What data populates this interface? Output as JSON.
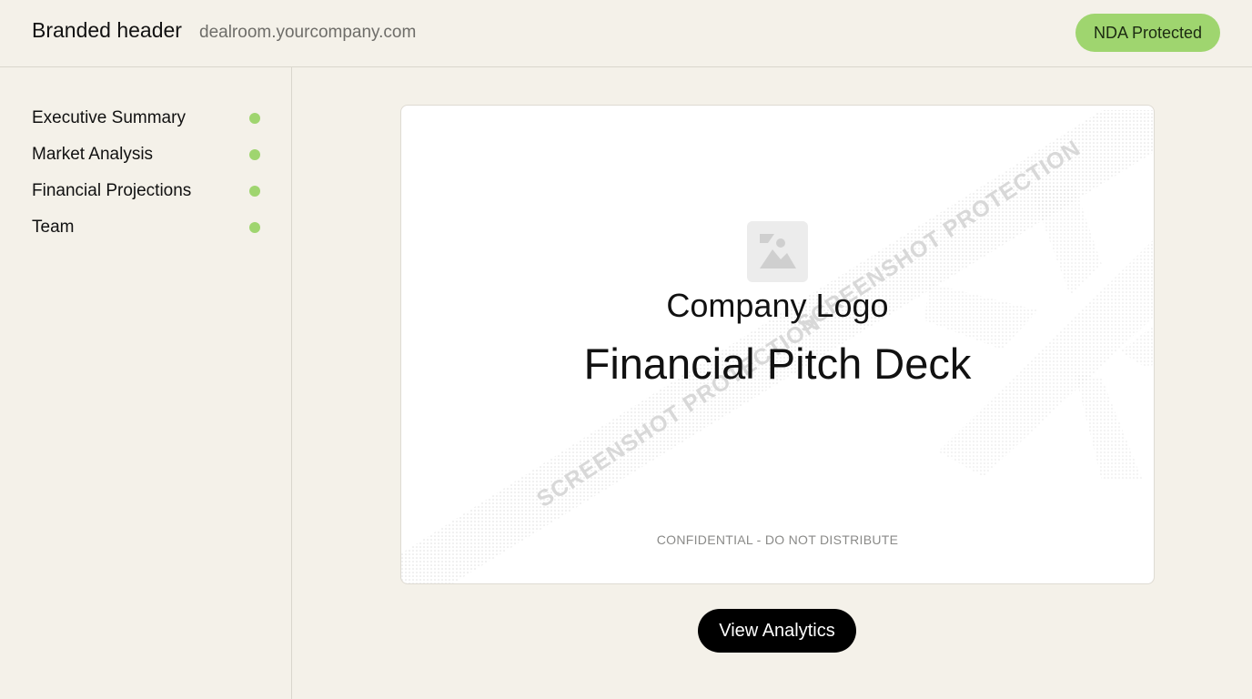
{
  "header": {
    "brand": "Branded header",
    "domain": "dealroom.yourcompany.com",
    "badge": "NDA Protected"
  },
  "sidebar": {
    "items": [
      {
        "label": "Executive Summary",
        "status": "complete"
      },
      {
        "label": "Market Analysis",
        "status": "complete"
      },
      {
        "label": "Financial Projections",
        "status": "complete"
      },
      {
        "label": "Team",
        "status": "complete"
      }
    ],
    "status_color": "#9fd56f"
  },
  "slide": {
    "logo_icon": "image-placeholder-icon",
    "logo_label": "Company Logo",
    "title": "Financial Pitch Deck",
    "watermark": "SCREENSHOT PROTECTION",
    "footer": "CONFIDENTIAL - DO NOT DISTRIBUTE"
  },
  "actions": {
    "view_analytics": "View Analytics"
  },
  "colors": {
    "background": "#f4f1e9",
    "accent": "#9fd56f",
    "button": "#000000"
  }
}
